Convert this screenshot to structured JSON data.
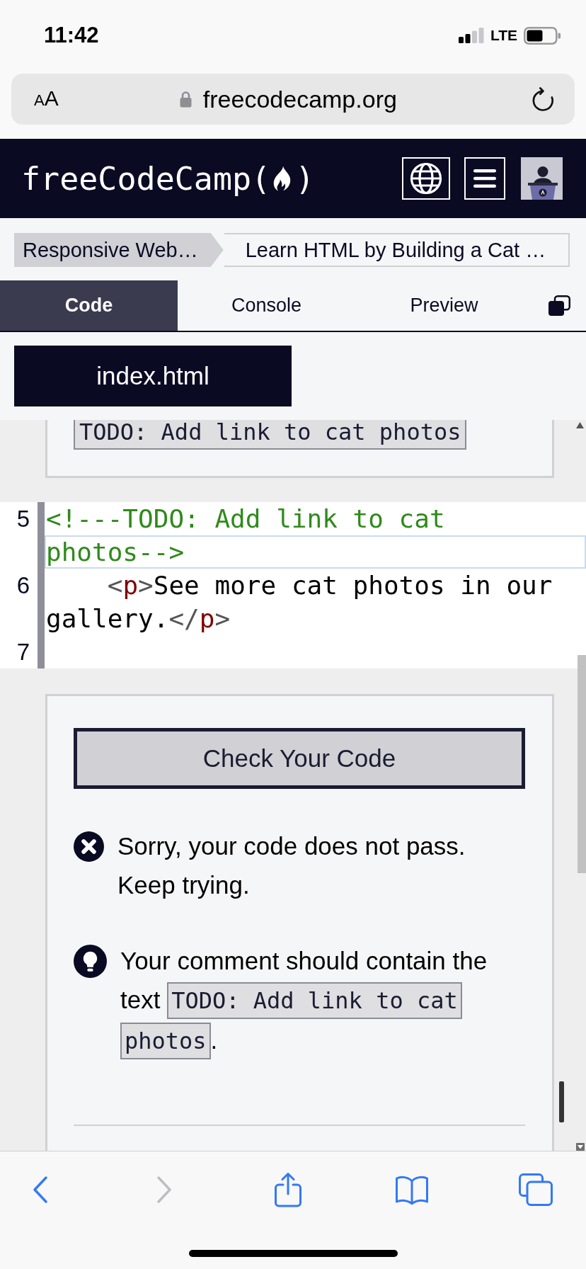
{
  "status_bar": {
    "time": "11:42",
    "network": "LTE"
  },
  "address_bar": {
    "reader_button": "AA",
    "url": "freecodecamp.org"
  },
  "site_header": {
    "logo_text": "freeCodeCamp(",
    "logo_text_end": ")"
  },
  "breadcrumbs": [
    {
      "label": "Responsive Web…"
    },
    {
      "label": "Learn HTML by Building a Cat …"
    }
  ],
  "tabs": [
    {
      "label": "Code",
      "selected": true
    },
    {
      "label": "Console",
      "selected": false
    },
    {
      "label": "Preview",
      "selected": false
    }
  ],
  "file_tabs": [
    {
      "label": "index.html"
    }
  ],
  "instructions": {
    "code": "TODO: Add link to cat photos"
  },
  "editor": {
    "lines": [
      {
        "number": "5",
        "cursor_line": true,
        "tokens": [
          {
            "kind": "comment",
            "text": "<!---TODO: Add link to cat photos-->"
          }
        ]
      },
      {
        "number": "6",
        "cursor_line": false,
        "tokens": [
          {
            "kind": "bracket",
            "text": "    <"
          },
          {
            "kind": "tag",
            "text": "p"
          },
          {
            "kind": "bracket",
            "text": ">"
          },
          {
            "kind": "text",
            "text": "See more cat photos in our gallery."
          },
          {
            "kind": "bracket",
            "text": "</"
          },
          {
            "kind": "tag",
            "text": "p"
          },
          {
            "kind": "bracket",
            "text": ">"
          }
        ]
      },
      {
        "number": "7",
        "cursor_line": false
      }
    ]
  },
  "feedback": {
    "button": "Check Your Code",
    "messages": [
      {
        "kind": "error",
        "parts": [
          {
            "kind": "text",
            "text": "Sorry, your code does not pass. Keep trying."
          }
        ]
      },
      {
        "kind": "hint",
        "parts": [
          {
            "kind": "text",
            "text": "Your comment should contain the text "
          },
          {
            "kind": "code",
            "text": "TODO: Add link to cat photos"
          },
          {
            "kind": "text",
            "text": "."
          }
        ]
      }
    ]
  },
  "toolbar": [
    {
      "kind": "back",
      "disabled": false
    },
    {
      "kind": "forward",
      "disabled": true
    },
    {
      "kind": "share",
      "disabled": false
    },
    {
      "kind": "bookmarks",
      "disabled": false
    },
    {
      "kind": "tabs",
      "disabled": false
    }
  ]
}
